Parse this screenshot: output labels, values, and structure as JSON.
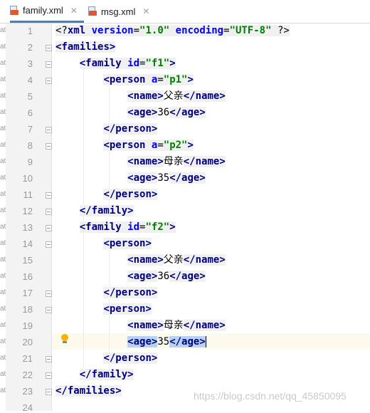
{
  "tabs": [
    {
      "label": "family.xml",
      "close": "✕",
      "active": true
    },
    {
      "label": "msg.xml",
      "close": "✕",
      "active": false
    }
  ],
  "line_numbers": [
    "1",
    "2",
    "3",
    "4",
    "5",
    "6",
    "7",
    "8",
    "9",
    "10",
    "11",
    "12",
    "13",
    "14",
    "15",
    "16",
    "17",
    "18",
    "19",
    "20",
    "21",
    "22",
    "23",
    "24"
  ],
  "left_strip_letters": [
    "at",
    "at",
    "at",
    "at",
    "at",
    "at",
    "at",
    "at",
    "at",
    "at",
    "at",
    "at",
    "at",
    "at",
    "at",
    "at",
    "at",
    "at",
    "at",
    "at",
    "at",
    "at",
    "at"
  ],
  "code": {
    "l1_decl_open": "<?",
    "l1_xml": "xml",
    "l1_version": "version",
    "l1_eq": "=",
    "l1_version_val": "\"1.0\"",
    "l1_encoding": "encoding",
    "l1_encoding_val": "\"UTF-8\"",
    "l1_decl_close": "?>",
    "families": "families",
    "family": "family",
    "person": "person",
    "name": "name",
    "age": "age",
    "id": "id",
    "a": "a",
    "f1": "\"f1\"",
    "f2": "\"f2\"",
    "p1": "\"p1\"",
    "p2": "\"p2\"",
    "father": "父亲",
    "mother": "母亲",
    "age36": "36",
    "age35": "35"
  },
  "watermark": "https://blog.csdn.net/qq_45850095",
  "icons": {
    "file": "xml-file-icon",
    "bulb": "lightbulb-icon"
  },
  "colors": {
    "tag": "#000080",
    "attr": "#0000ff",
    "value": "#008000",
    "selection": "#b6d3f5",
    "current_line": "#fcfaed"
  }
}
